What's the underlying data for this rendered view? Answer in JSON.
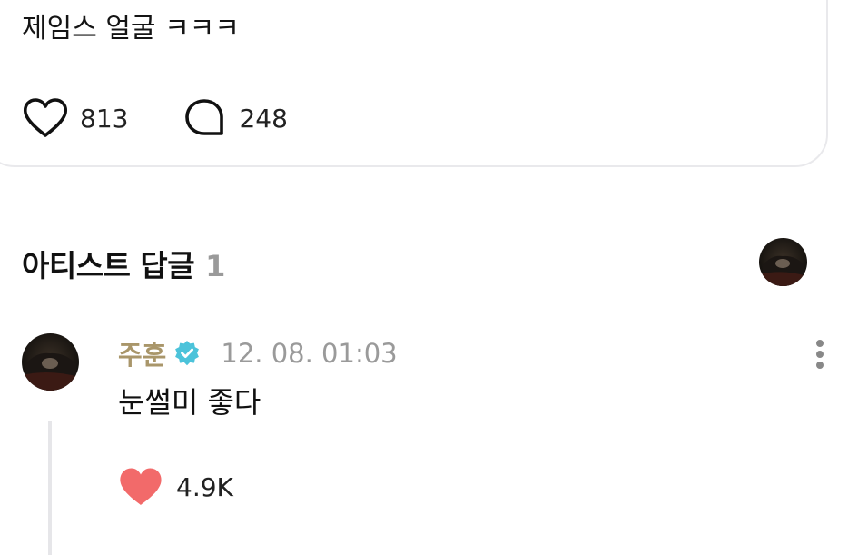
{
  "post": {
    "text": "제임스 얼굴 ㅋㅋㅋ",
    "like_count": "813",
    "comment_count": "248",
    "like_icon": "heart-outline-icon",
    "comment_icon": "speech-bubble-icon"
  },
  "artist_replies": {
    "title": "아티스트 답글",
    "count": "1"
  },
  "comment": {
    "author": "주훈",
    "verified_icon": "verified-badge-icon",
    "timestamp": "12. 08. 01:03",
    "text": "눈썰미 좋다",
    "like_count": "4.9K",
    "like_icon": "heart-filled-icon",
    "more_icon": "more-vertical-icon"
  },
  "colors": {
    "author_name": "#a9966a",
    "verified_badge": "#4cc3da",
    "liked_heart": "#f26a6a",
    "muted_text": "#9a9a9a",
    "card_border": "#e9e9ec"
  }
}
